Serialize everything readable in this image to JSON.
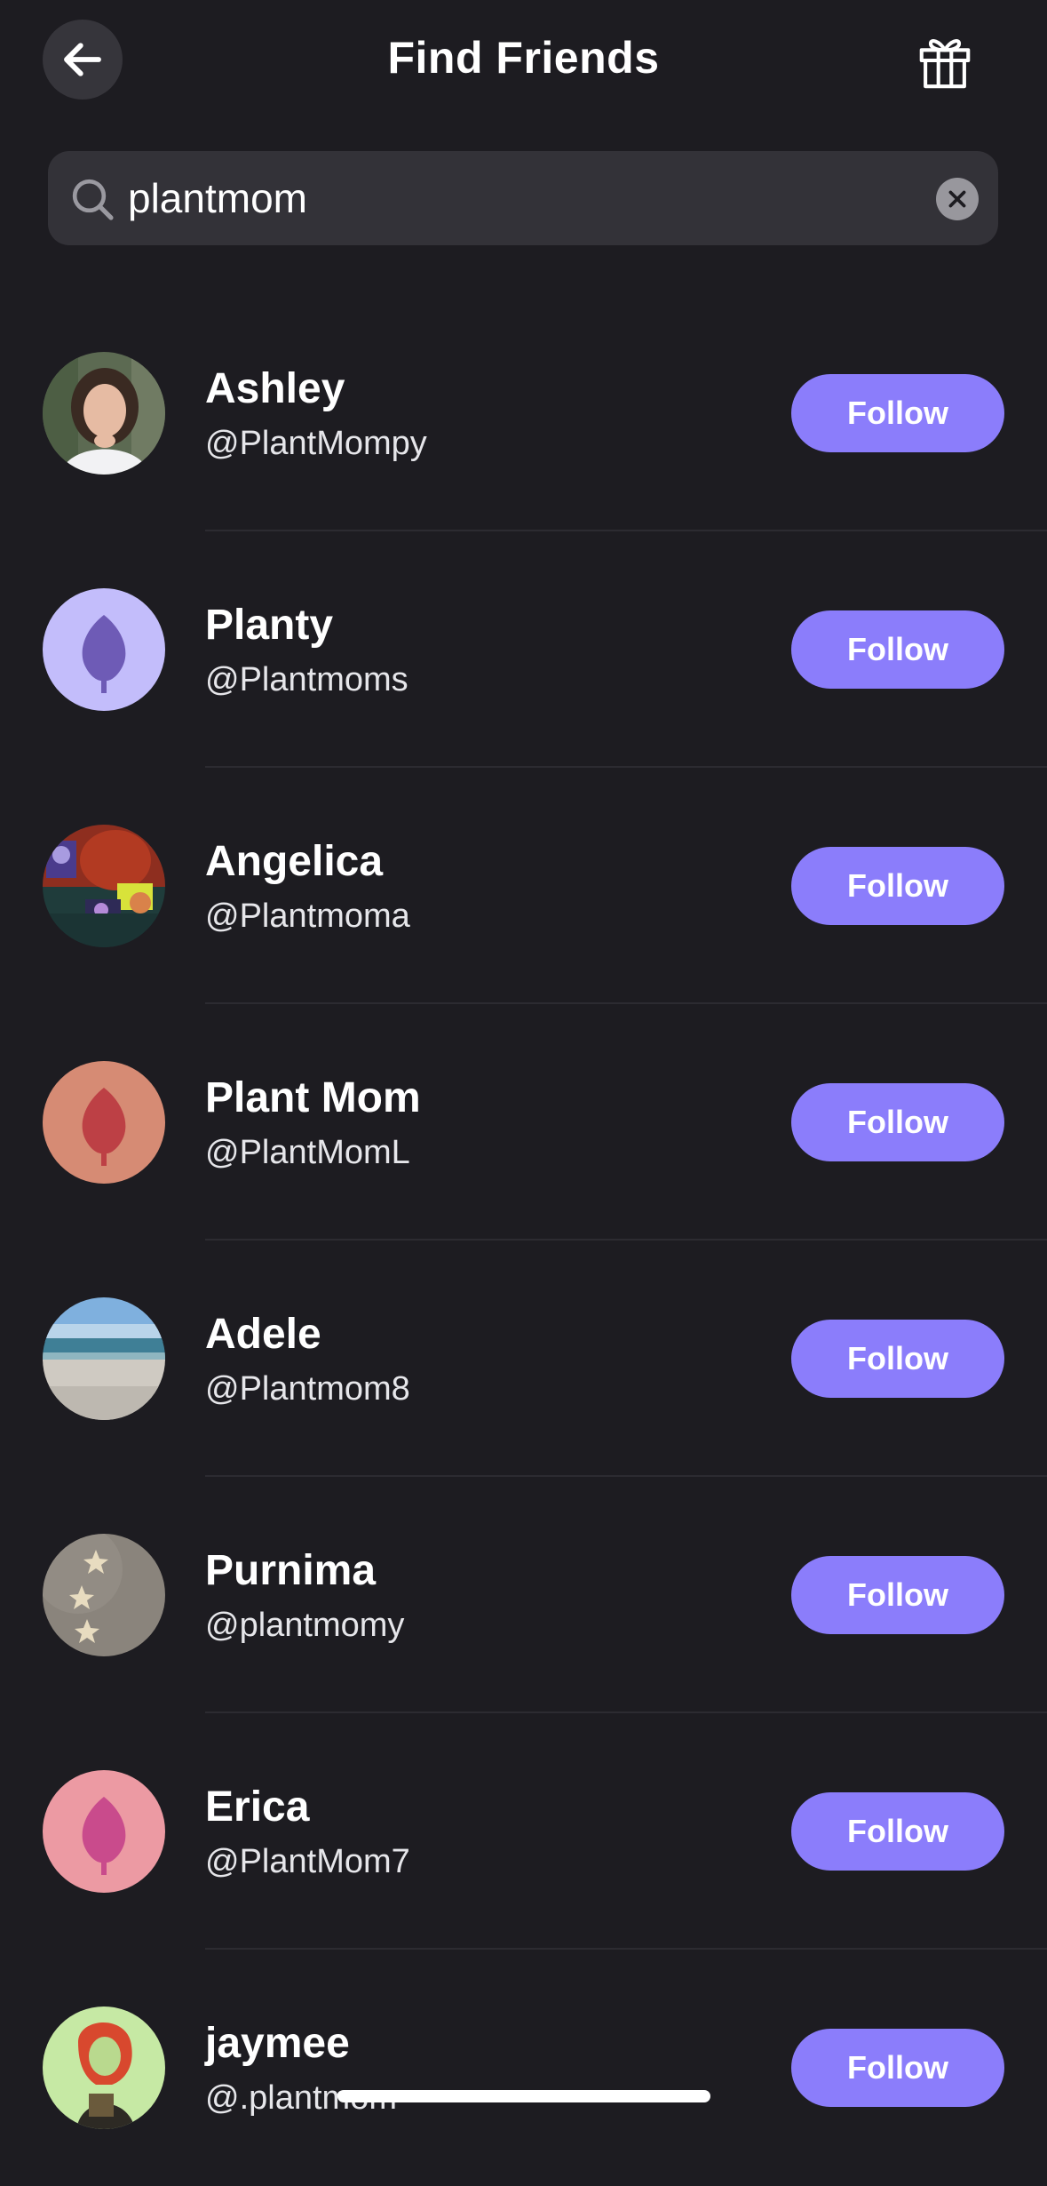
{
  "header": {
    "title": "Find Friends",
    "back_icon": "arrow-left-icon",
    "gift_icon": "gift-icon"
  },
  "search": {
    "value": "plantmom",
    "icon": "search-icon",
    "clear_icon": "clear-icon"
  },
  "colors": {
    "background": "#1d1c21",
    "accent": "#8b7dfb",
    "search_bg": "#333238"
  },
  "results": [
    {
      "name": "Ashley",
      "handle": "@PlantMompy",
      "follow_label": "Follow",
      "avatar": "photo-woman-portrait"
    },
    {
      "name": "Planty",
      "handle": "@Plantmoms",
      "follow_label": "Follow",
      "avatar": "leaf-purple"
    },
    {
      "name": "Angelica",
      "handle": "@Plantmoma",
      "follow_label": "Follow",
      "avatar": "photo-collage"
    },
    {
      "name": "Plant Mom",
      "handle": "@PlantMomL",
      "follow_label": "Follow",
      "avatar": "leaf-red"
    },
    {
      "name": "Adele",
      "handle": "@Plantmom8",
      "follow_label": "Follow",
      "avatar": "photo-beach"
    },
    {
      "name": "Purnima",
      "handle": "@plantmomy",
      "follow_label": "Follow",
      "avatar": "photo-starfish-sand"
    },
    {
      "name": "Erica",
      "handle": "@PlantMom7",
      "follow_label": "Follow",
      "avatar": "leaf-pink"
    },
    {
      "name": "jaymee",
      "handle": "@.plantmom",
      "follow_label": "Follow",
      "avatar": "illustration-character"
    }
  ]
}
